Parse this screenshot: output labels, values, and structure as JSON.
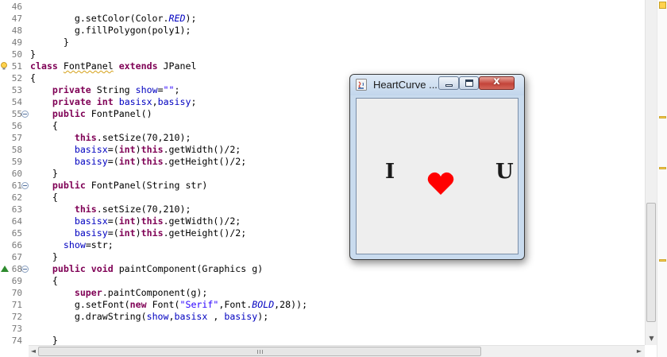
{
  "editor": {
    "lines": [
      {
        "n": "46",
        "segs": [
          {
            "t": ""
          }
        ]
      },
      {
        "n": "47",
        "segs": [
          {
            "t": "        g.setColor(Color."
          },
          {
            "t": "RED",
            "c": "ital"
          },
          {
            "t": ");"
          }
        ]
      },
      {
        "n": "48",
        "segs": [
          {
            "t": "        g.fillPolygon(poly1);"
          }
        ]
      },
      {
        "n": "49",
        "segs": [
          {
            "t": "      }"
          }
        ]
      },
      {
        "n": "50",
        "segs": [
          {
            "t": "}"
          }
        ]
      },
      {
        "n": "51",
        "segs": [
          {
            "t": "class ",
            "c": "kw"
          },
          {
            "t": "FontPanel",
            "c": "warn-underline"
          },
          {
            "t": " "
          },
          {
            "t": "extends",
            "c": "kw"
          },
          {
            "t": " JPanel"
          }
        ],
        "marker": "warn"
      },
      {
        "n": "52",
        "segs": [
          {
            "t": "{"
          }
        ]
      },
      {
        "n": "53",
        "segs": [
          {
            "t": "    "
          },
          {
            "t": "private",
            "c": "kw"
          },
          {
            "t": " String "
          },
          {
            "t": "show",
            "c": "fld"
          },
          {
            "t": "="
          },
          {
            "t": "\"\"",
            "c": "str"
          },
          {
            "t": ";"
          }
        ]
      },
      {
        "n": "54",
        "segs": [
          {
            "t": "    "
          },
          {
            "t": "private",
            "c": "kw"
          },
          {
            "t": " "
          },
          {
            "t": "int",
            "c": "kw"
          },
          {
            "t": " "
          },
          {
            "t": "basisx",
            "c": "fld"
          },
          {
            "t": ","
          },
          {
            "t": "basisy",
            "c": "fld"
          },
          {
            "t": ";"
          }
        ]
      },
      {
        "n": "55",
        "segs": [
          {
            "t": "    "
          },
          {
            "t": "public",
            "c": "kw"
          },
          {
            "t": " FontPanel()"
          }
        ],
        "fold": true
      },
      {
        "n": "56",
        "segs": [
          {
            "t": "    {"
          }
        ]
      },
      {
        "n": "57",
        "segs": [
          {
            "t": "        "
          },
          {
            "t": "this",
            "c": "kw"
          },
          {
            "t": ".setSize(70,210);"
          }
        ]
      },
      {
        "n": "58",
        "segs": [
          {
            "t": "        "
          },
          {
            "t": "basisx",
            "c": "fld"
          },
          {
            "t": "=("
          },
          {
            "t": "int",
            "c": "kw"
          },
          {
            "t": ")"
          },
          {
            "t": "this",
            "c": "kw"
          },
          {
            "t": ".getWidth()/2;"
          }
        ]
      },
      {
        "n": "59",
        "segs": [
          {
            "t": "        "
          },
          {
            "t": "basisy",
            "c": "fld"
          },
          {
            "t": "=("
          },
          {
            "t": "int",
            "c": "kw"
          },
          {
            "t": ")"
          },
          {
            "t": "this",
            "c": "kw"
          },
          {
            "t": ".getHeight()/2;"
          }
        ]
      },
      {
        "n": "60",
        "segs": [
          {
            "t": "    }"
          }
        ]
      },
      {
        "n": "61",
        "segs": [
          {
            "t": "    "
          },
          {
            "t": "public",
            "c": "kw"
          },
          {
            "t": " FontPanel(String str)"
          }
        ],
        "fold": true
      },
      {
        "n": "62",
        "segs": [
          {
            "t": "    {"
          }
        ]
      },
      {
        "n": "63",
        "segs": [
          {
            "t": "        "
          },
          {
            "t": "this",
            "c": "kw"
          },
          {
            "t": ".setSize(70,210);"
          }
        ]
      },
      {
        "n": "64",
        "segs": [
          {
            "t": "        "
          },
          {
            "t": "basisx",
            "c": "fld"
          },
          {
            "t": "=("
          },
          {
            "t": "int",
            "c": "kw"
          },
          {
            "t": ")"
          },
          {
            "t": "this",
            "c": "kw"
          },
          {
            "t": ".getWidth()/2;"
          }
        ]
      },
      {
        "n": "65",
        "segs": [
          {
            "t": "        "
          },
          {
            "t": "basisy",
            "c": "fld"
          },
          {
            "t": "=("
          },
          {
            "t": "int",
            "c": "kw"
          },
          {
            "t": ")"
          },
          {
            "t": "this",
            "c": "kw"
          },
          {
            "t": ".getHeight()/2;"
          }
        ]
      },
      {
        "n": "66",
        "segs": [
          {
            "t": "      "
          },
          {
            "t": "show",
            "c": "fld"
          },
          {
            "t": "=str;"
          }
        ]
      },
      {
        "n": "67",
        "segs": [
          {
            "t": "    }"
          }
        ]
      },
      {
        "n": "68",
        "segs": [
          {
            "t": "    "
          },
          {
            "t": "public",
            "c": "kw"
          },
          {
            "t": " "
          },
          {
            "t": "void",
            "c": "kw"
          },
          {
            "t": " paintComponent(Graphics g)"
          }
        ],
        "fold": true,
        "marker": "override"
      },
      {
        "n": "69",
        "segs": [
          {
            "t": "    {"
          }
        ]
      },
      {
        "n": "70",
        "segs": [
          {
            "t": "        "
          },
          {
            "t": "super",
            "c": "kw"
          },
          {
            "t": ".paintComponent(g);"
          }
        ]
      },
      {
        "n": "71",
        "segs": [
          {
            "t": "        g.setFont("
          },
          {
            "t": "new",
            "c": "kw"
          },
          {
            "t": " Font("
          },
          {
            "t": "\"Serif\"",
            "c": "str"
          },
          {
            "t": ",Font."
          },
          {
            "t": "BOLD",
            "c": "ital"
          },
          {
            "t": ",28));"
          }
        ]
      },
      {
        "n": "72",
        "segs": [
          {
            "t": "        g.drawString("
          },
          {
            "t": "show",
            "c": "fld"
          },
          {
            "t": ","
          },
          {
            "t": "basisx",
            "c": "fld"
          },
          {
            "t": " , "
          },
          {
            "t": "basisy",
            "c": "fld"
          },
          {
            "t": ");"
          }
        ]
      },
      {
        "n": "73",
        "segs": [
          {
            "t": ""
          }
        ]
      },
      {
        "n": "74",
        "segs": [
          {
            "t": "    }"
          }
        ]
      }
    ]
  },
  "window": {
    "title": "HeartCurve ...",
    "close_glyph": "x",
    "left_letter": "I",
    "right_letter": "U",
    "heart_color": "#ff0000",
    "icon": "java-icon"
  },
  "scrollbars": {
    "vertical_down_glyph": "▼",
    "horizontal_left_glyph": "◄",
    "horizontal_right_glyph": "►"
  },
  "colors": {
    "keyword": "#7f0055",
    "field": "#0000c0",
    "string": "#2a00ff",
    "line_number": "#787878"
  }
}
